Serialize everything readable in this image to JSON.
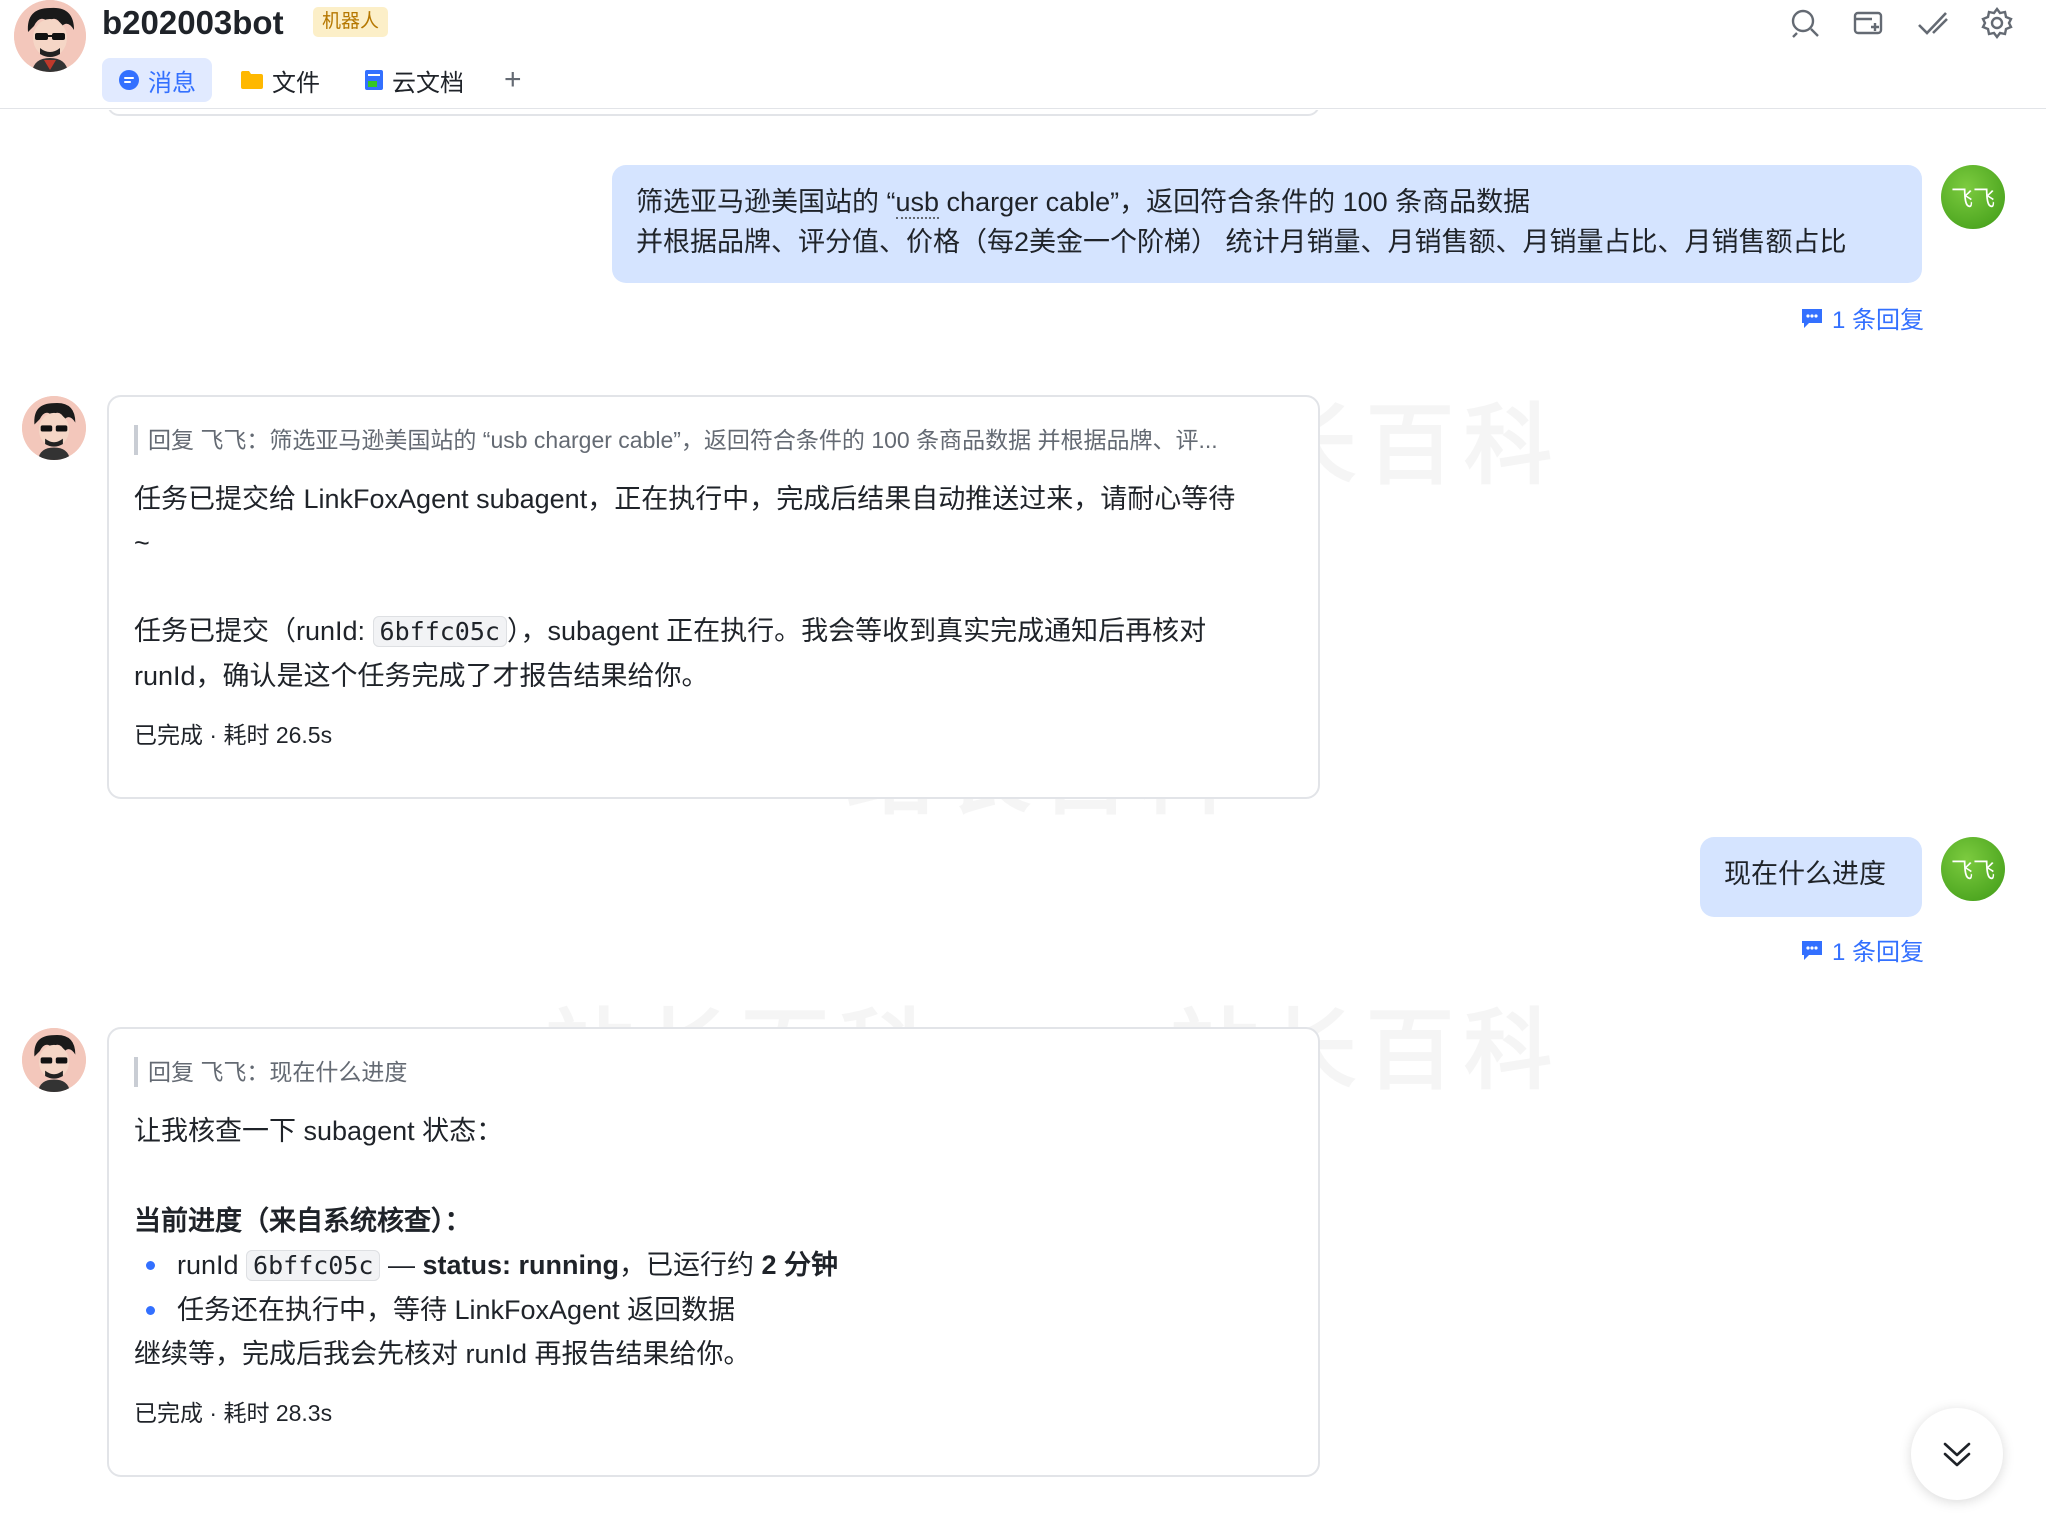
{
  "header": {
    "bot_name": "b202003bot",
    "badge": "机器人",
    "tabs": [
      {
        "label": "消息",
        "icon": "message-icon",
        "active": true
      },
      {
        "label": "文件",
        "icon": "folder-icon",
        "active": false
      },
      {
        "label": "云文档",
        "icon": "doc-icon",
        "active": false
      }
    ],
    "add_tab": "+",
    "icons": [
      "search-icon",
      "new-window-icon",
      "check-task-icon",
      "settings-icon"
    ]
  },
  "user": {
    "avatar_text": "飞飞",
    "color": "#4caf1f"
  },
  "messages": [
    {
      "type": "user",
      "lines": [
        "筛选亚马逊美国站的 “usb charger cable”，返回符合条件的 100 条商品数据",
        "并根据品牌、评分值、价格（每2美金一个阶梯） 统计月销量、月销售额、月销量占比、月销售额占比"
      ],
      "reply_count": "1 条回复"
    },
    {
      "type": "bot",
      "quote": "回复 飞飞：筛选亚马逊美国站的 “usb charger cable”，返回符合条件的 100 条商品数据 并根据品牌、评...",
      "p1": "任务已提交给 LinkFoxAgent subagent，正在执行中，完成后结果自动推送过来，请耐心等待",
      "p1_tail": "~",
      "p2_prefix": "任务已提交（runId: ",
      "p2_code": "6bffc05c",
      "p2_rest": "），subagent 正在执行。我会等收到真实完成通知后再核对",
      "p2_line2": "runId，确认是这个任务完成了才报告结果给你。",
      "status": "已完成 · 耗时 26.5s"
    },
    {
      "type": "user",
      "text": "现在什么进度",
      "reply_count": "1 条回复"
    },
    {
      "type": "bot",
      "quote": "回复 飞飞：现在什么进度",
      "intro": "让我核查一下 subagent 状态：",
      "heading": "当前进度（来自系统核查）：",
      "b1_prefix": "runId ",
      "b1_code": "6bffc05c",
      "b1_dash": " — ",
      "b1_status": "status: running",
      "b1_mid": "，已运行约 ",
      "b1_time": "2 分钟",
      "b2": "任务还在执行中，等待 LinkFoxAgent 返回数据",
      "outro": "继续等，完成后我会先核对 runId 再报告结果给你。",
      "status": "已完成 · 耗时 28.3s"
    }
  ],
  "watermark": "站长百科"
}
